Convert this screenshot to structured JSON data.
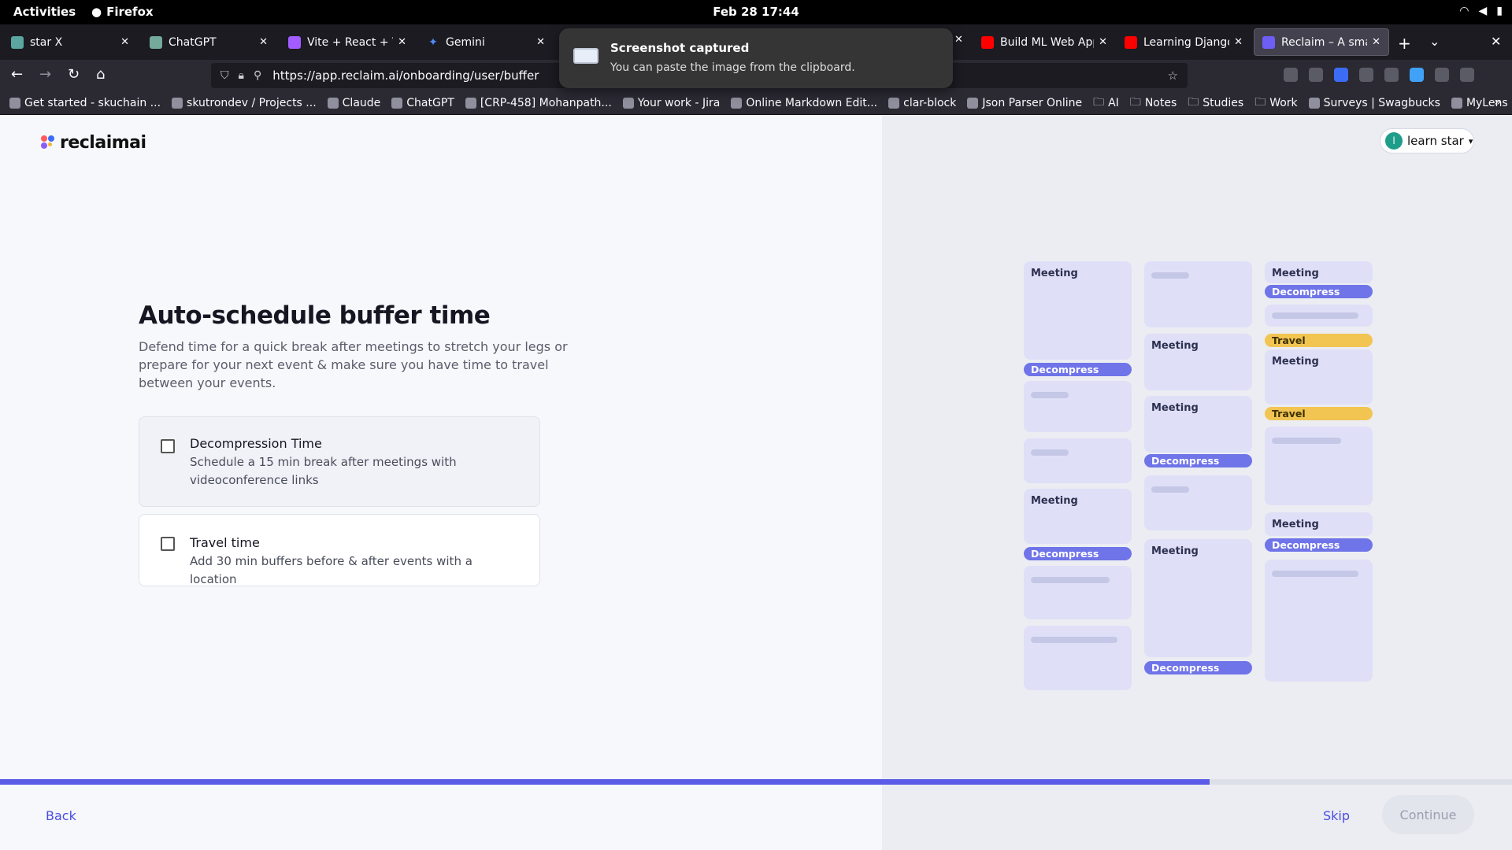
{
  "system": {
    "activities": "Activities",
    "app_name": "Firefox",
    "clock": "Feb 28  17:44"
  },
  "tabs": [
    {
      "label": "star X",
      "color": "#5ba6a0"
    },
    {
      "label": "ChatGPT",
      "color": "#74aa9c"
    },
    {
      "label": "Vite + React + TS",
      "color": "#a35cff"
    },
    {
      "label": "Gemini",
      "color": "#4f8ef7"
    },
    {
      "label": "Build ML Web App",
      "color": "#ff0000"
    },
    {
      "label": "Learning Django [",
      "color": "#ff0000"
    },
    {
      "label": "Reclaim – A smart",
      "color": "#6d5ef5"
    }
  ],
  "notification": {
    "title": "Screenshot captured",
    "body": "You can paste the image from the clipboard."
  },
  "url": "https://app.reclaim.ai/onboarding/user/buffer",
  "bookmarks": [
    "Get started - skuchain ...",
    "skutrondev / Projects ...",
    "Claude",
    "ChatGPT",
    "[CRP-458] Mohanpath...",
    "Your work - Jira",
    "Online Markdown Edit...",
    "clar-block",
    "Json Parser Online",
    "AI",
    "Notes",
    "Studies",
    "Work",
    "Surveys | Swagbucks",
    "MyLens"
  ],
  "brand": {
    "name": "reclaimai",
    "colors": [
      "#ff5a5f",
      "#3c6cf6",
      "#8b5cf6",
      "#f5b52e"
    ]
  },
  "user": {
    "initial": "l",
    "name": "learn star"
  },
  "main": {
    "title": "Auto-schedule buffer time",
    "description": "Defend time for a quick break after meetings to stretch your legs or prepare for your next event & make sure you have time to travel between your events.",
    "options": [
      {
        "title": "Decompression Time",
        "subtitle": "Schedule a 15 min break after meetings with videoconference links",
        "checked": false
      },
      {
        "title": "Travel time",
        "subtitle": "Add 30 min buffers before & after events with a location",
        "checked": false
      }
    ]
  },
  "calendar_labels": {
    "meeting": "Meeting",
    "decompress": "Decompress",
    "travel": "Travel"
  },
  "footer": {
    "back": "Back",
    "skip": "Skip",
    "continue": "Continue",
    "progress": 0.8
  }
}
